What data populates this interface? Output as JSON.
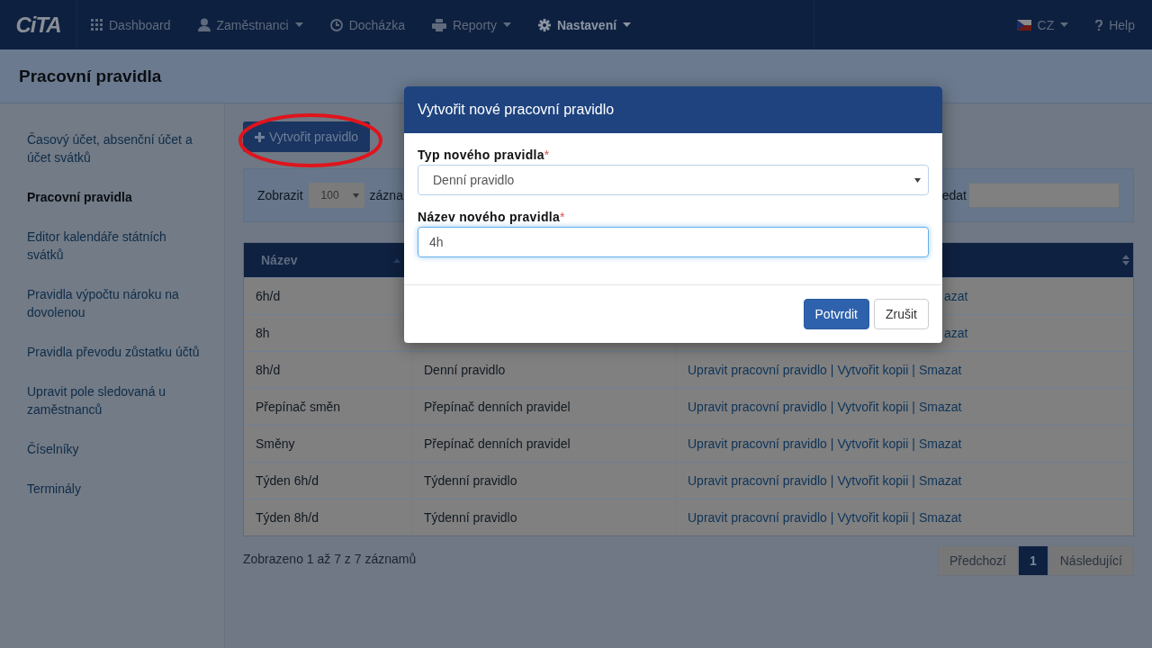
{
  "navbar": {
    "logo": "CiTA",
    "items": [
      {
        "label": "Dashboard",
        "kind": "grid",
        "caret": false,
        "selected": false
      },
      {
        "label": "Zaměstnanci",
        "kind": "user",
        "caret": true,
        "selected": false
      },
      {
        "label": "Docházka",
        "kind": "clock",
        "caret": false,
        "selected": false
      },
      {
        "label": "Reporty",
        "kind": "printer",
        "caret": true,
        "selected": false
      },
      {
        "label": "Nastavení",
        "kind": "gear",
        "caret": true,
        "selected": true
      }
    ],
    "language": "CZ",
    "help": "Help"
  },
  "page_title": "Pracovní pravidla",
  "sidebar": {
    "items": [
      {
        "label": "Časový účet, absenční účet a účet svátků",
        "selected": false
      },
      {
        "label": "Pracovní pravidla",
        "selected": true
      },
      {
        "label": "Editor kalendáře státních svátků",
        "selected": false
      },
      {
        "label": "Pravidla výpočtu nároku na dovolenou",
        "selected": false
      },
      {
        "label": "Pravidla převodu zůstatku účtů",
        "selected": false
      },
      {
        "label": "Upravit pole sledovaná u zaměstnanců",
        "selected": false
      },
      {
        "label": "Číselníky",
        "selected": false
      },
      {
        "label": "Terminály",
        "selected": false
      }
    ]
  },
  "create_button": "Vytvořit pravidlo",
  "filter": {
    "show_label": "Zobrazit",
    "page_size": "100",
    "records_label": "zázna",
    "search_label": "edat"
  },
  "table": {
    "columns": [
      "Název"
    ],
    "separator": "|",
    "rows": [
      {
        "kind": "covered",
        "name": "6h/d",
        "actions": [
          "azat"
        ]
      },
      {
        "kind": "covered",
        "name": "8h",
        "actions": [
          "azat"
        ]
      },
      {
        "kind": "full",
        "name": "8h/d",
        "type": "Denní pravidlo",
        "actions": [
          "Upravit pracovní pravidlo",
          "Vytvořit kopii",
          "Smazat"
        ]
      },
      {
        "kind": "full",
        "name": "Přepínač směn",
        "type": "Přepínač denních pravidel",
        "actions": [
          "Upravit pracovní pravidlo",
          "Vytvořit kopii",
          "Smazat"
        ]
      },
      {
        "kind": "full",
        "name": "Směny",
        "type": "Přepínač denních pravidel",
        "actions": [
          "Upravit pracovní pravidlo",
          "Vytvořit kopii",
          "Smazat"
        ]
      },
      {
        "kind": "full",
        "name": "Týden 6h/d",
        "type": "Týdenní pravidlo",
        "actions": [
          "Upravit pracovní pravidlo",
          "Vytvořit kopii",
          "Smazat"
        ]
      },
      {
        "kind": "full",
        "name": "Týden 8h/d",
        "type": "Týdenní pravidlo",
        "actions": [
          "Upravit pracovní pravidlo",
          "Vytvořit kopii",
          "Smazat"
        ]
      }
    ]
  },
  "info": "Zobrazeno 1 až 7 z 7 záznamů",
  "pagination": [
    {
      "label": "Předchozí",
      "selected": false
    },
    {
      "label": "1",
      "selected": true
    },
    {
      "label": "Následující",
      "selected": false
    }
  ],
  "modal": {
    "title": "Vytvořit nové pracovní pravidlo",
    "fields": [
      {
        "kind": "select",
        "label": "Typ nového pravidla",
        "required_mark": "*",
        "value": "Denní pravidlo",
        "focused": false
      },
      {
        "kind": "text",
        "label": "Název nového pravidla",
        "required_mark": "*",
        "value": "4h",
        "focused": true
      }
    ],
    "buttons": [
      {
        "label": "Potvrdit",
        "primary": true
      },
      {
        "label": "Zrušit",
        "primary": false
      }
    ]
  }
}
